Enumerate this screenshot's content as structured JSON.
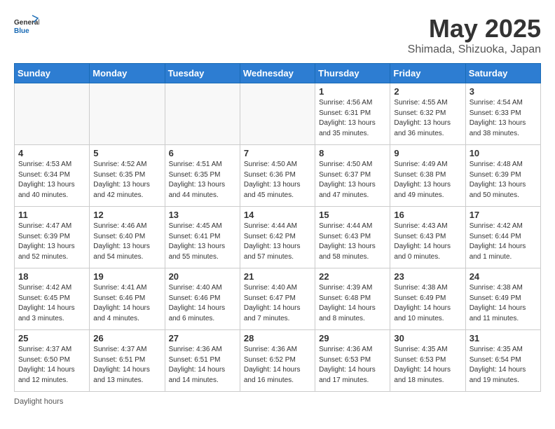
{
  "header": {
    "logo_general": "General",
    "logo_blue": "Blue",
    "title": "May 2025",
    "subtitle": "Shimada, Shizuoka, Japan"
  },
  "days_of_week": [
    "Sunday",
    "Monday",
    "Tuesday",
    "Wednesday",
    "Thursday",
    "Friday",
    "Saturday"
  ],
  "weeks": [
    [
      {
        "day": "",
        "detail": ""
      },
      {
        "day": "",
        "detail": ""
      },
      {
        "day": "",
        "detail": ""
      },
      {
        "day": "",
        "detail": ""
      },
      {
        "day": "1",
        "detail": "Sunrise: 4:56 AM\nSunset: 6:31 PM\nDaylight: 13 hours\nand 35 minutes."
      },
      {
        "day": "2",
        "detail": "Sunrise: 4:55 AM\nSunset: 6:32 PM\nDaylight: 13 hours\nand 36 minutes."
      },
      {
        "day": "3",
        "detail": "Sunrise: 4:54 AM\nSunset: 6:33 PM\nDaylight: 13 hours\nand 38 minutes."
      }
    ],
    [
      {
        "day": "4",
        "detail": "Sunrise: 4:53 AM\nSunset: 6:34 PM\nDaylight: 13 hours\nand 40 minutes."
      },
      {
        "day": "5",
        "detail": "Sunrise: 4:52 AM\nSunset: 6:35 PM\nDaylight: 13 hours\nand 42 minutes."
      },
      {
        "day": "6",
        "detail": "Sunrise: 4:51 AM\nSunset: 6:35 PM\nDaylight: 13 hours\nand 44 minutes."
      },
      {
        "day": "7",
        "detail": "Sunrise: 4:50 AM\nSunset: 6:36 PM\nDaylight: 13 hours\nand 45 minutes."
      },
      {
        "day": "8",
        "detail": "Sunrise: 4:50 AM\nSunset: 6:37 PM\nDaylight: 13 hours\nand 47 minutes."
      },
      {
        "day": "9",
        "detail": "Sunrise: 4:49 AM\nSunset: 6:38 PM\nDaylight: 13 hours\nand 49 minutes."
      },
      {
        "day": "10",
        "detail": "Sunrise: 4:48 AM\nSunset: 6:39 PM\nDaylight: 13 hours\nand 50 minutes."
      }
    ],
    [
      {
        "day": "11",
        "detail": "Sunrise: 4:47 AM\nSunset: 6:39 PM\nDaylight: 13 hours\nand 52 minutes."
      },
      {
        "day": "12",
        "detail": "Sunrise: 4:46 AM\nSunset: 6:40 PM\nDaylight: 13 hours\nand 54 minutes."
      },
      {
        "day": "13",
        "detail": "Sunrise: 4:45 AM\nSunset: 6:41 PM\nDaylight: 13 hours\nand 55 minutes."
      },
      {
        "day": "14",
        "detail": "Sunrise: 4:44 AM\nSunset: 6:42 PM\nDaylight: 13 hours\nand 57 minutes."
      },
      {
        "day": "15",
        "detail": "Sunrise: 4:44 AM\nSunset: 6:43 PM\nDaylight: 13 hours\nand 58 minutes."
      },
      {
        "day": "16",
        "detail": "Sunrise: 4:43 AM\nSunset: 6:43 PM\nDaylight: 14 hours\nand 0 minutes."
      },
      {
        "day": "17",
        "detail": "Sunrise: 4:42 AM\nSunset: 6:44 PM\nDaylight: 14 hours\nand 1 minute."
      }
    ],
    [
      {
        "day": "18",
        "detail": "Sunrise: 4:42 AM\nSunset: 6:45 PM\nDaylight: 14 hours\nand 3 minutes."
      },
      {
        "day": "19",
        "detail": "Sunrise: 4:41 AM\nSunset: 6:46 PM\nDaylight: 14 hours\nand 4 minutes."
      },
      {
        "day": "20",
        "detail": "Sunrise: 4:40 AM\nSunset: 6:46 PM\nDaylight: 14 hours\nand 6 minutes."
      },
      {
        "day": "21",
        "detail": "Sunrise: 4:40 AM\nSunset: 6:47 PM\nDaylight: 14 hours\nand 7 minutes."
      },
      {
        "day": "22",
        "detail": "Sunrise: 4:39 AM\nSunset: 6:48 PM\nDaylight: 14 hours\nand 8 minutes."
      },
      {
        "day": "23",
        "detail": "Sunrise: 4:38 AM\nSunset: 6:49 PM\nDaylight: 14 hours\nand 10 minutes."
      },
      {
        "day": "24",
        "detail": "Sunrise: 4:38 AM\nSunset: 6:49 PM\nDaylight: 14 hours\nand 11 minutes."
      }
    ],
    [
      {
        "day": "25",
        "detail": "Sunrise: 4:37 AM\nSunset: 6:50 PM\nDaylight: 14 hours\nand 12 minutes."
      },
      {
        "day": "26",
        "detail": "Sunrise: 4:37 AM\nSunset: 6:51 PM\nDaylight: 14 hours\nand 13 minutes."
      },
      {
        "day": "27",
        "detail": "Sunrise: 4:36 AM\nSunset: 6:51 PM\nDaylight: 14 hours\nand 14 minutes."
      },
      {
        "day": "28",
        "detail": "Sunrise: 4:36 AM\nSunset: 6:52 PM\nDaylight: 14 hours\nand 16 minutes."
      },
      {
        "day": "29",
        "detail": "Sunrise: 4:36 AM\nSunset: 6:53 PM\nDaylight: 14 hours\nand 17 minutes."
      },
      {
        "day": "30",
        "detail": "Sunrise: 4:35 AM\nSunset: 6:53 PM\nDaylight: 14 hours\nand 18 minutes."
      },
      {
        "day": "31",
        "detail": "Sunrise: 4:35 AM\nSunset: 6:54 PM\nDaylight: 14 hours\nand 19 minutes."
      }
    ]
  ],
  "footer": {
    "note": "Daylight hours"
  }
}
